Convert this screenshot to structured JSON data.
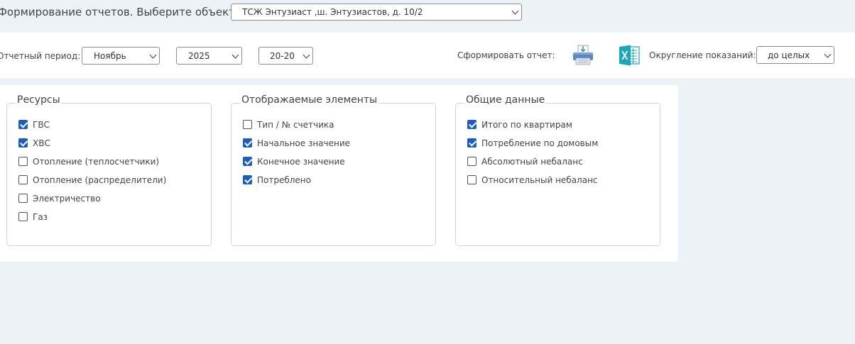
{
  "header": {
    "title": "Формирование отчетов. Выберите объект:",
    "object_select": {
      "value": "ТСЖ Энтузиаст ,ш. Энтузиастов, д. 10/2"
    }
  },
  "period": {
    "label": "Отчетный период:",
    "month": "Ноябрь",
    "year": "2025",
    "days": "20-20"
  },
  "report": {
    "label": "Сформировать отчет:",
    "print_icon": "printer-icon",
    "excel_icon": "excel-icon"
  },
  "rounding": {
    "label": "Округление показаний:",
    "value": "до целых"
  },
  "colors": {
    "page_bg": "#edf2f7",
    "panel_bg": "#ffffff",
    "checkbox_accent": "#1a5dc4",
    "excel_teal": "#18a6b8",
    "printer_blue": "#5a86c5"
  },
  "groups": {
    "resources": {
      "title": "Ресурсы",
      "items": [
        {
          "label": "ГВС",
          "checked": true
        },
        {
          "label": "ХВС",
          "checked": true
        },
        {
          "label": "Отопление (теплосчетчики)",
          "checked": false
        },
        {
          "label": "Отопление (распределители)",
          "checked": false
        },
        {
          "label": "Электричество",
          "checked": false
        },
        {
          "label": "Газ",
          "checked": false
        }
      ]
    },
    "elements": {
      "title": "Отображаемые элементы",
      "items": [
        {
          "label": "Тип / № счетчика",
          "checked": false
        },
        {
          "label": "Начальное значение",
          "checked": true
        },
        {
          "label": "Конечное значение",
          "checked": true
        },
        {
          "label": "Потреблено",
          "checked": true
        }
      ]
    },
    "general": {
      "title": "Общие данные",
      "items": [
        {
          "label": "Итого по квартирам",
          "checked": true
        },
        {
          "label": "Потребление по домовым",
          "checked": true
        },
        {
          "label": "Абсолютный небаланс",
          "checked": false
        },
        {
          "label": "Относительный небаланс",
          "checked": false
        }
      ]
    }
  }
}
